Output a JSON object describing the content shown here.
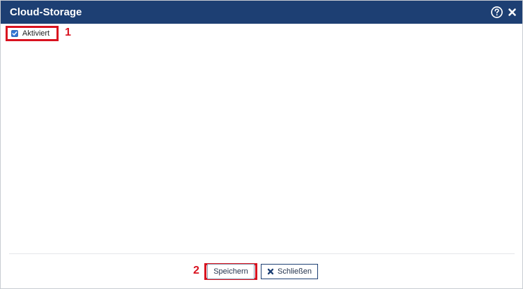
{
  "dialog": {
    "title": "Cloud-Storage"
  },
  "form": {
    "enabled_label": "Aktiviert",
    "enabled_checked": true
  },
  "annotations": {
    "marker_1": "1",
    "marker_2": "2"
  },
  "footer": {
    "save_label": "Speichern",
    "close_label": "Schließen"
  },
  "icons": {
    "help": "help-circle-icon",
    "close": "close-icon",
    "close_button": "x-icon"
  },
  "colors": {
    "titlebar": "#1d3f73",
    "highlight": "#d9121f",
    "checkbox": "#2f76d6"
  }
}
